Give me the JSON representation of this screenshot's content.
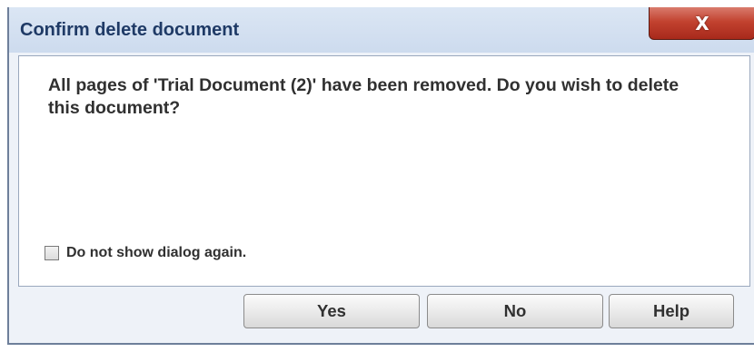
{
  "window": {
    "title": "Confirm delete document",
    "close_glyph": "X"
  },
  "content": {
    "message": "All pages of 'Trial Document (2)' have been removed. Do you wish to delete this document?"
  },
  "checkbox": {
    "label": "Do not show dialog again.",
    "checked": false
  },
  "buttons": {
    "yes": "Yes",
    "no": "No",
    "help": "Help"
  },
  "colors": {
    "title_text": "#1f3a66",
    "close_button": "#c2422f",
    "dialog_bg": "#eef2f8"
  }
}
